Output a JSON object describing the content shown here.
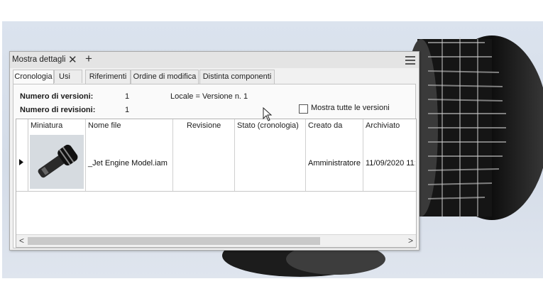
{
  "panel": {
    "title": "Mostra dettagli",
    "close_glyph": "✕",
    "add_glyph": "+"
  },
  "tabs": [
    {
      "label": "Cronologia",
      "active": true
    },
    {
      "label": "Usi"
    },
    {
      "label": "Riferimenti"
    },
    {
      "label": "Ordine di modifica"
    },
    {
      "label": "Distinta componenti"
    }
  ],
  "info": {
    "versions_label": "Numero di versioni:",
    "versions_value": "1",
    "revisions_label": "Numero di revisioni:",
    "revisions_value": "1",
    "locale_text": "Locale = Versione n. 1",
    "show_all_label": "Mostra tutte le versioni",
    "show_all_checked": false
  },
  "table": {
    "columns": [
      "Miniatura",
      "Nome file",
      "Revisione",
      "Stato (cronologia)",
      "Creato da",
      "Archiviato"
    ],
    "rows": [
      {
        "thumbnail": "jet-engine-thumbnail",
        "file_name": "_Jet Engine Model.iam",
        "revision": "",
        "state": "",
        "created_by": "Amministratore",
        "archived": "11/09/2020 11:"
      }
    ]
  },
  "scrollbar": {
    "left_arrow": "<",
    "right_arrow": ">"
  },
  "colors": {
    "viewport_bg": "#d7dfea",
    "panel_bg": "#f1f1f1"
  }
}
